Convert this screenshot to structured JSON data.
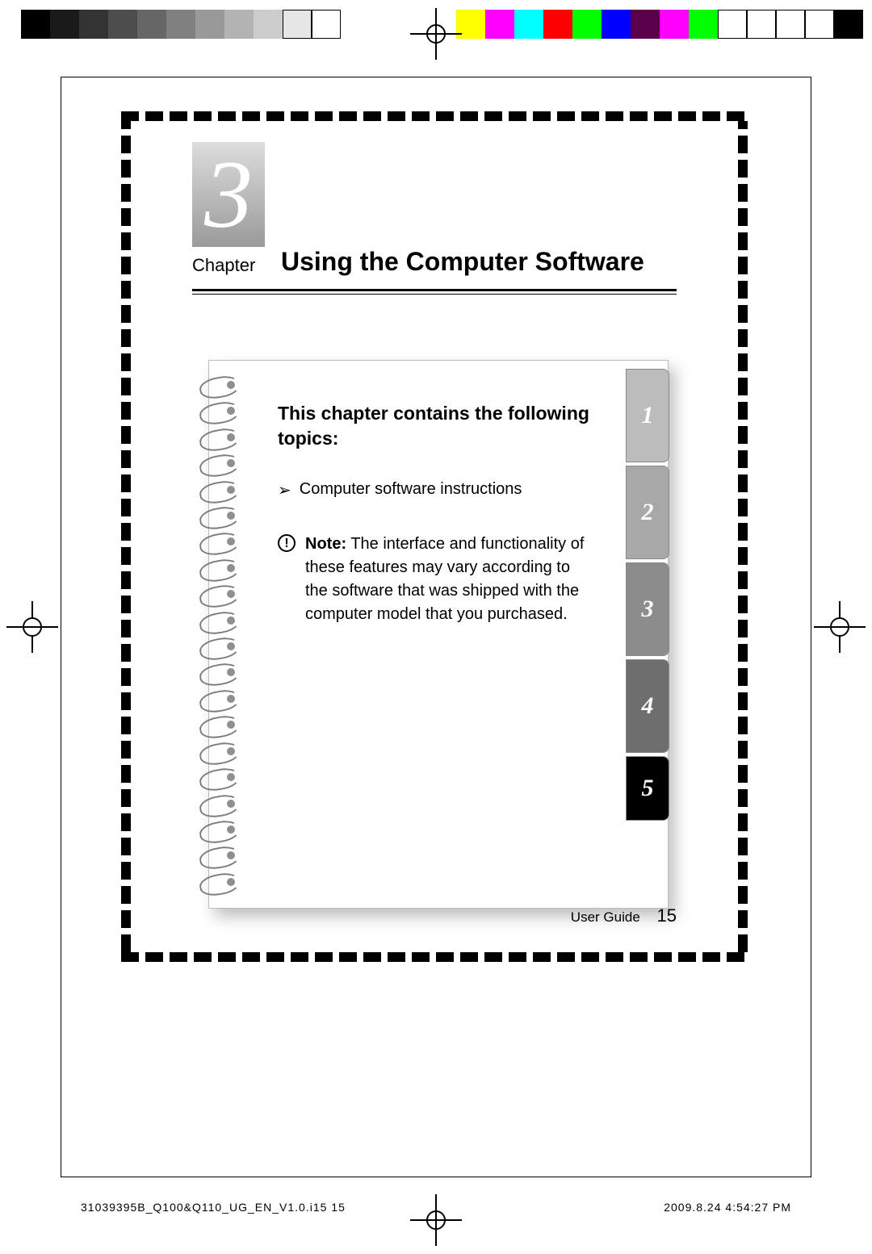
{
  "chapter": {
    "number": "3",
    "label": "Chapter",
    "title": "Using the Computer Software"
  },
  "notebook": {
    "heading": "This chapter contains the following topics:",
    "topics": [
      "Computer software instructions"
    ],
    "note_label": "Note:",
    "note_text": "The interface and functionality of these features may vary according to the software that was shipped with the computer model that you purchased."
  },
  "tabs": [
    "1",
    "2",
    "3",
    "4",
    "5"
  ],
  "footer": {
    "book": "User Guide",
    "page": "15"
  },
  "jobline": {
    "left": "31039395B_Q100&Q110_UG_EN_V1.0.i15   15",
    "right": "2009.8.24   4:54:27 PM"
  }
}
